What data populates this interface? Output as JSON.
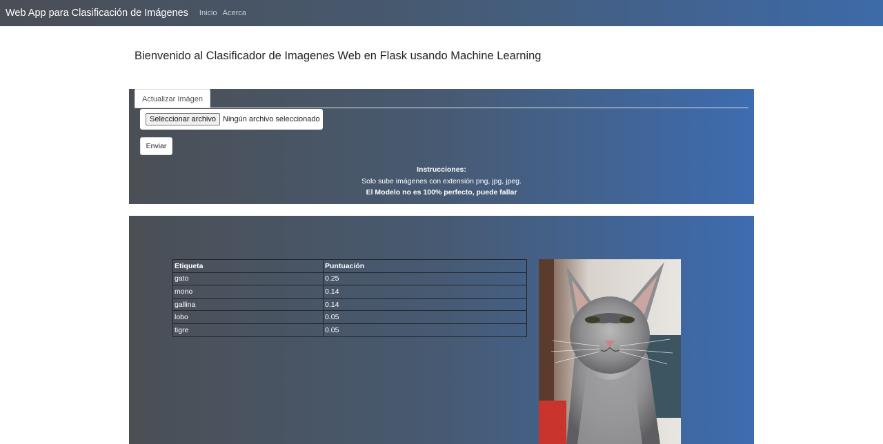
{
  "navbar": {
    "brand": "Web App para Clasificación de Imágenes",
    "links": [
      "Inicio",
      "Acerca"
    ]
  },
  "page_title": "Bienvenido al Clasificador de Imagenes Web en Flask usando Machine Learning",
  "upload": {
    "tab_label": "Actualizar Imágen",
    "file_button": "Seleccionar archivo",
    "file_status": "Ningún archivo seleccionado",
    "submit_label": "Enviar",
    "instructions_title": "Instrucciones:",
    "instructions_line": "Solo sube imágenes con extensión png, jpg, jpeg.",
    "instructions_warning": "El Modelo no es 100% perfecto, puede fallar"
  },
  "results": {
    "headers": [
      "Etiqueta",
      "Puntuación"
    ],
    "rows": [
      [
        "gato",
        "0.25"
      ],
      [
        "mono",
        "0.14"
      ],
      [
        "gallina",
        "0.14"
      ],
      [
        "lobo",
        "0.05"
      ],
      [
        "tigre",
        "0.05"
      ]
    ]
  },
  "colors": {
    "navbar_gradient": [
      "#4a4e56",
      "#3d6aa9"
    ],
    "panel_gradient": [
      "#4b4f55",
      "#3d6cb0"
    ]
  }
}
